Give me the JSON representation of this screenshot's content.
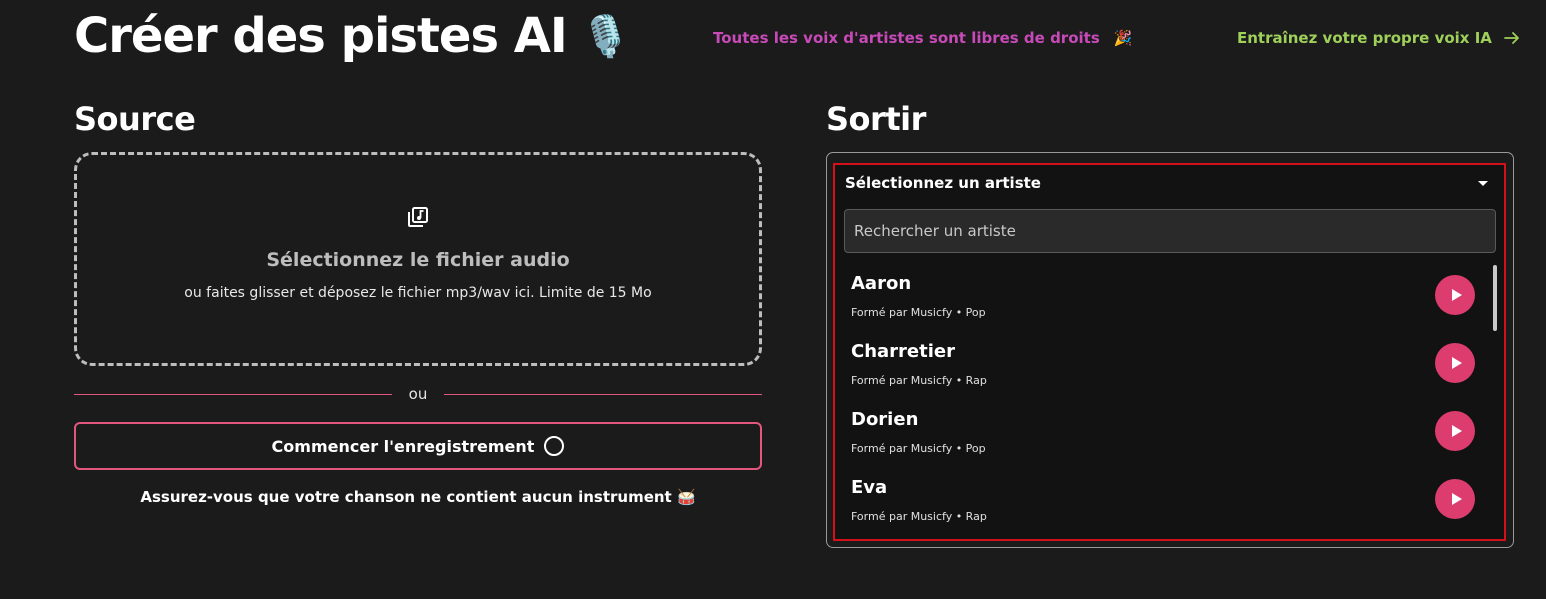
{
  "header": {
    "title": "Créer des pistes AI",
    "title_icon": "microphone-icon",
    "royalty_free_link": "Toutes les voix d'artistes sont libres de droits",
    "royalty_free_icon": "party-popper-icon",
    "train_voice_link": "Entraînez votre propre voix IA",
    "train_voice_icon": "arrow-right-icon"
  },
  "source": {
    "heading": "Source",
    "dropzone": {
      "icon": "music-library-icon",
      "title": "Sélectionnez le fichier audio",
      "subtitle": "ou faites glisser et déposez le fichier mp3/wav ici. Limite de 15 Mo"
    },
    "divider_label": "ou",
    "record_button": "Commencer l'enregistrement",
    "note": "Assurez-vous que votre chanson ne contient aucun instrument 🥁"
  },
  "output": {
    "heading": "Sortir",
    "select_label": "Sélectionnez un artiste",
    "search_placeholder": "Rechercher un artiste",
    "artists": [
      {
        "name": "Aaron",
        "meta": "Formé par Musicfy • Pop"
      },
      {
        "name": "Charretier",
        "meta": "Formé par Musicfy • Rap"
      },
      {
        "name": "Dorien",
        "meta": "Formé par Musicfy • Pop"
      },
      {
        "name": "Eva",
        "meta": "Formé par Musicfy • Rap"
      }
    ]
  },
  "colors": {
    "background": "#1b1b1b",
    "accent_pink": "#dc3d6e",
    "link_purple": "#c84ab8",
    "link_green": "#9ed05a",
    "highlight_red": "#d4101b"
  }
}
